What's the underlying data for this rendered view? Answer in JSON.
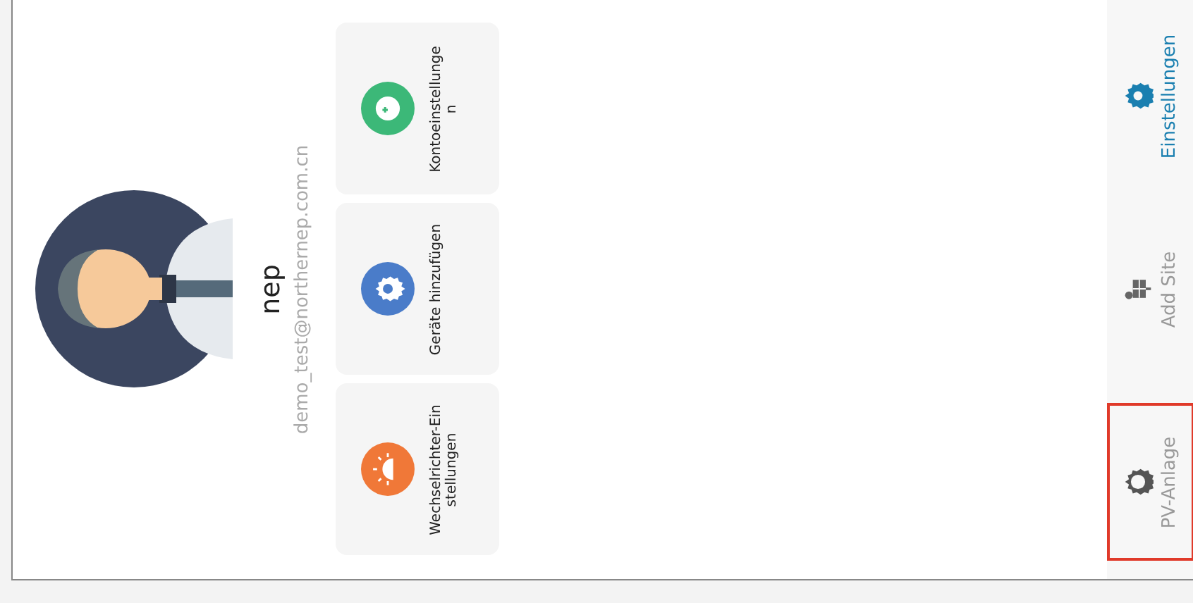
{
  "profile": {
    "name": "nep",
    "email": "demo_test@northernep.com.cn"
  },
  "cards": [
    {
      "kind": "inverter",
      "label": "Wechselrichter-Einstellungen",
      "color": "#f07838"
    },
    {
      "kind": "device",
      "label": "Geräte hinzufügen",
      "color": "#4a7cc9"
    },
    {
      "kind": "account",
      "label": "Kontoeinstellungen",
      "color": "#3cb878"
    }
  ],
  "tabs": [
    {
      "kind": "gear-outline",
      "label": "PV-Anlage",
      "selected": false,
      "highlighted": true
    },
    {
      "kind": "panel",
      "label": "Add Site",
      "selected": false,
      "highlighted": false
    },
    {
      "kind": "gear",
      "label": "Einstellungen",
      "selected": true,
      "highlighted": false
    }
  ]
}
